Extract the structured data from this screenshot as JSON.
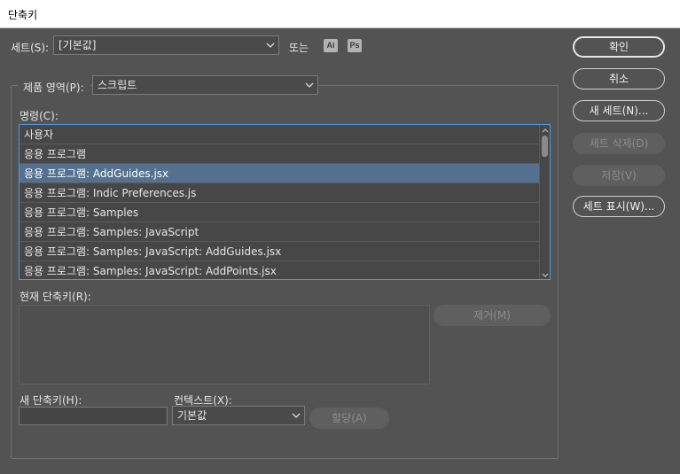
{
  "window": {
    "title": "단축키"
  },
  "set": {
    "label": "세트(S):",
    "value": "[기본값]",
    "or_label": "또는",
    "app_badges": [
      "Ai",
      "Ps"
    ]
  },
  "product_area": {
    "label": "제품 영역(P):",
    "value": "스크립트"
  },
  "commands": {
    "label": "명령(C):",
    "items": [
      "사용자",
      "응용 프로그램",
      "응용 프로그램: AddGuides.jsx",
      "응용 프로그램: Indic Preferences.js",
      "응용 프로그램: Samples",
      "응용 프로그램: Samples: JavaScript",
      "응용 프로그램: Samples: JavaScript: AddGuides.jsx",
      "응용 프로그램: Samples: JavaScript: AddPoints.jsx"
    ],
    "selected_index": 2
  },
  "current_shortcuts": {
    "label": "현재 단축키(R):",
    "remove_label": "제거(M)"
  },
  "new_shortcut": {
    "label": "새 단축키(H):",
    "value": ""
  },
  "context": {
    "label": "컨텍스트(X):",
    "value": "기본값"
  },
  "assign_label": "할당(A)",
  "buttons": {
    "ok": "확인",
    "cancel": "취소",
    "new_set": "새 세트(N)...",
    "delete_set": "세트 삭제(D)",
    "save": "저장(V)",
    "show_set": "세트 표시(W)..."
  },
  "colors": {
    "background": "#535353",
    "selection": "#56708f",
    "focus_border": "#4d9ae0"
  }
}
